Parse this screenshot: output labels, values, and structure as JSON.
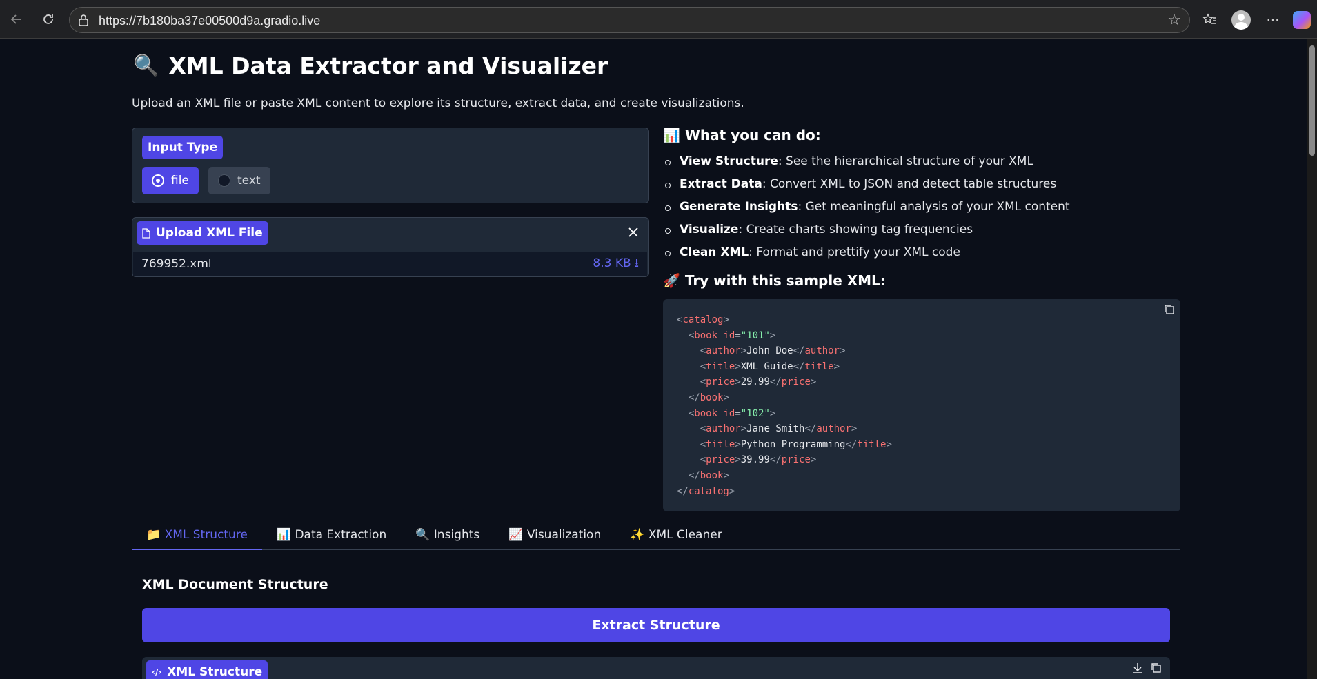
{
  "browser": {
    "url": "https://7b180ba37e00500d9a.gradio.live"
  },
  "header": {
    "title_emoji": "🔍",
    "title": "XML Data Extractor and Visualizer",
    "subtitle": "Upload an XML file or paste XML content to explore its structure, extract data, and create visualizations."
  },
  "input_type": {
    "label": "Input Type",
    "options": [
      "file",
      "text"
    ],
    "selected": "file"
  },
  "upload": {
    "label": "Upload XML File",
    "file_name": "769952.xml",
    "file_size": "8.3 KB ⭳"
  },
  "info": {
    "heading_emoji": "📊",
    "heading": "What you can do:",
    "items": [
      {
        "bold": "View Structure",
        "text": ": See the hierarchical structure of your XML"
      },
      {
        "bold": "Extract Data",
        "text": ": Convert XML to JSON and detect table structures"
      },
      {
        "bold": "Generate Insights",
        "text": ": Get meaningful analysis of your XML content"
      },
      {
        "bold": "Visualize",
        "text": ": Create charts showing tag frequencies"
      },
      {
        "bold": "Clean XML",
        "text": ": Format and prettify your XML code"
      }
    ],
    "sample_emoji": "🚀",
    "sample_heading": "Try with this sample XML:"
  },
  "tabs": [
    {
      "icon": "📁",
      "label": "XML Structure"
    },
    {
      "icon": "📊",
      "label": "Data Extraction"
    },
    {
      "icon": "🔍",
      "label": "Insights"
    },
    {
      "icon": "📈",
      "label": "Visualization"
    },
    {
      "icon": "✨",
      "label": "XML Cleaner"
    }
  ],
  "structure": {
    "title": "XML Document Structure",
    "button": "Extract Structure",
    "output_label": "XML Structure"
  },
  "colors": {
    "accent": "#4f46e5",
    "background": "#0b0f19",
    "panel": "#1f2937"
  }
}
